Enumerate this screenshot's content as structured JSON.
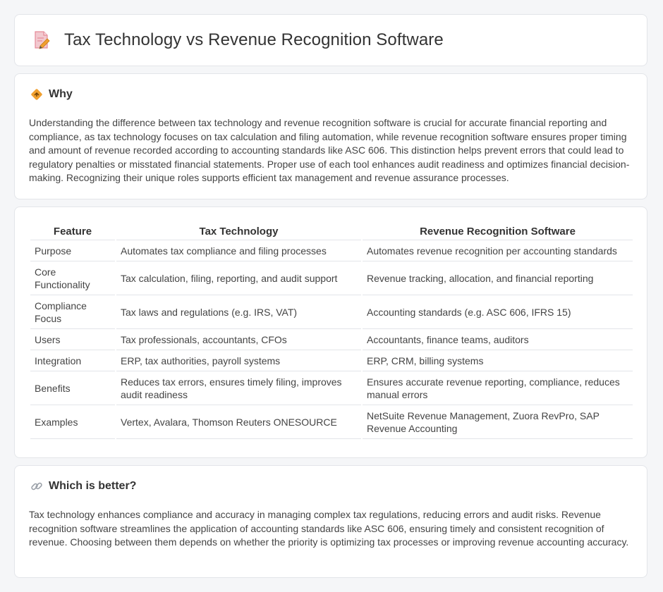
{
  "page": {
    "title": "Tax Technology vs Revenue Recognition Software"
  },
  "why": {
    "heading": "Why",
    "text": "Understanding the difference between tax technology and revenue recognition software is crucial for accurate financial reporting and compliance, as tax technology focuses on tax calculation and filing automation, while revenue recognition software ensures proper timing and amount of revenue recorded according to accounting standards like ASC 606. This distinction helps prevent errors that could lead to regulatory penalties or misstated financial statements. Proper use of each tool enhances audit readiness and optimizes financial decision-making. Recognizing their unique roles supports efficient tax management and revenue assurance processes."
  },
  "table": {
    "headers": [
      "Feature",
      "Tax Technology",
      "Revenue Recognition Software"
    ],
    "rows": [
      [
        "Purpose",
        "Automates tax compliance and filing processes",
        "Automates revenue recognition per accounting standards"
      ],
      [
        "Core Functionality",
        "Tax calculation, filing, reporting, and audit support",
        "Revenue tracking, allocation, and financial reporting"
      ],
      [
        "Compliance Focus",
        "Tax laws and regulations (e.g. IRS, VAT)",
        "Accounting standards (e.g. ASC 606, IFRS 15)"
      ],
      [
        "Users",
        "Tax professionals, accountants, CFOs",
        "Accountants, finance teams, auditors"
      ],
      [
        "Integration",
        "ERP, tax authorities, payroll systems",
        "ERP, CRM, billing systems"
      ],
      [
        "Benefits",
        "Reduces tax errors, ensures timely filing, improves audit readiness",
        "Ensures accurate revenue reporting, compliance, reduces manual errors"
      ],
      [
        "Examples",
        "Vertex, Avalara, Thomson Reuters ONESOURCE",
        "NetSuite Revenue Management, Zuora RevPro, SAP Revenue Accounting"
      ]
    ]
  },
  "better": {
    "heading": "Which is better?",
    "text": "Tax technology enhances compliance and accuracy in managing complex tax regulations, reducing errors and audit risks. Revenue recognition software streamlines the application of accounting standards like ASC 606, ensuring timely and consistent recognition of revenue. Choosing between them depends on whether the priority is optimizing tax processes or improving revenue accounting accuracy."
  },
  "icons": {
    "title": "document-pencil-icon",
    "why": "diamond-sign-icon",
    "better": "link-icon"
  },
  "colors": {
    "icon_accent": "#f0a030",
    "icon_pink": "#f28a9b",
    "link_gray": "#9aa0a8"
  }
}
